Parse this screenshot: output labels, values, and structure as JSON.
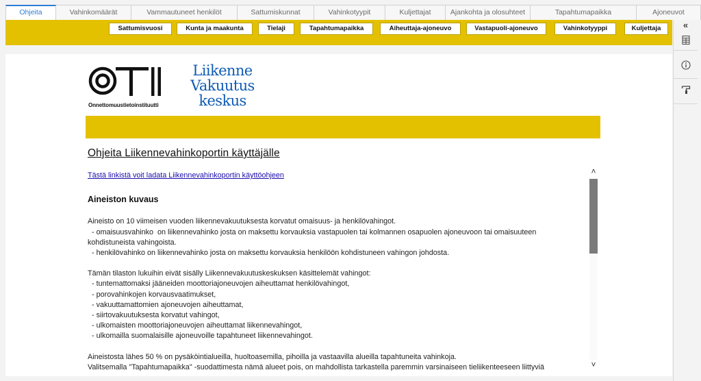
{
  "tabs": [
    {
      "label": "Ohjeita",
      "active": true
    },
    {
      "label": "Vahinkomäärät"
    },
    {
      "label": "Vammautuneet henkilöt"
    },
    {
      "label": "Sattumiskunnat"
    },
    {
      "label": "Vahinkotyypit"
    },
    {
      "label": "Kuljettajat"
    },
    {
      "label": "Ajankohta ja olosuhteet"
    },
    {
      "label": "Tapahtumapaikka"
    },
    {
      "label": "Ajoneuvot"
    }
  ],
  "filters": [
    "Sattumisvuosi",
    "Kunta ja maakunta",
    "Tielaji",
    "Tapahtumapaikka",
    "Aiheuttaja-ajoneuvo",
    "Vastapuoli-ajoneuvo",
    "Vahinkotyyppi",
    "Kuljettaja"
  ],
  "logos": {
    "oti_letters": "OTI",
    "oti_caption": "Onnettomuustietoinstituutti",
    "lvk_lines": [
      "Liikenne",
      "Vakuutus",
      "keskus"
    ]
  },
  "report": {
    "title": "Ohjeita Liikennevahinkoportin käyttäjälle",
    "download_link": "Tästä linkistä voit ladata Liikennevahinkoportin käyttöohjeen",
    "section_heading": "Aineiston kuvaus",
    "intro": "Aineisto on 10 viimeisen vuoden liikennevakuutuksesta korvatut omaisuus- ja henkilövahingot.",
    "definitions": [
      "  - omaisuusvahinko  on liikennevahinko josta on maksettu korvauksia vastapuolen tai kolmannen osapuolen ajoneuvoon tai omaisuuteen",
      "kohdistuneista vahingoista.",
      "  - henkilövahinko on liikennevahinko josta on maksettu korvauksia henkilöön kohdistuneen vahingon johdosta."
    ],
    "exclusions_intro": "Tämän tilaston lukuihin eivät sisälly Liikennevakuutuskeskuksen käsittelemät vahingot:",
    "exclusions": [
      "  - tuntemattomaksi jääneiden moottoriajoneuvojen aiheuttamat henkilövahingot,",
      "  - porovahinkojen korvausvaatimukset,",
      "  - vakuuttamattomien ajoneuvojen aiheuttamat,",
      "  - siirtovakuutuksesta korvatut vahingot,",
      "  - ulkomaisten moottoriajoneuvojen aiheuttamat liikennevahingot,",
      "  - ulkomailla suomalaisille ajoneuvoille tapahtuneet liikennevahingot."
    ],
    "closing": [
      "Aineistosta lähes 50 % on pysäköintialueilla, huoltoasemilla, pihoilla ja vastaavilla alueilla tapahtuneita vahinkoja.",
      "Valitsemalla \"Tapahtumapaikka\" -suodattimesta nämä alueet pois, on mahdollista tarkastella paremmin varsinaiseen tieliikenteeseen liittyviä"
    ]
  },
  "scrollbar": {
    "up": "˄",
    "down": "˅"
  },
  "rail": {
    "collapse_glyph": "«"
  },
  "colors": {
    "accent_yellow": "#e4c100",
    "tab_active_blue": "#2b7cd3",
    "lvk_blue": "#0e5bb3",
    "link": "#1a0dab"
  }
}
